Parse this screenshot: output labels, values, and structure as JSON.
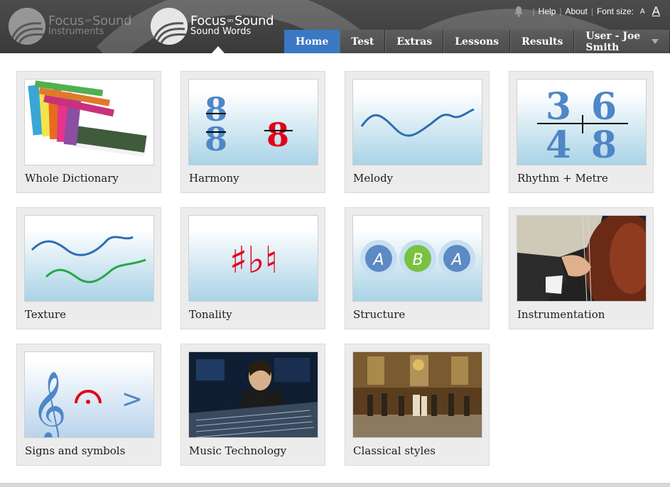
{
  "header": {
    "logos": [
      {
        "brand_a": "Focus",
        "brand_on": "on",
        "brand_b": "Sound",
        "sub": "Instruments"
      },
      {
        "brand_a": "Focus",
        "brand_on": "on",
        "brand_b": "Sound",
        "sub": "Sound Words"
      }
    ],
    "utility": {
      "bell_icon": "bell-icon",
      "help": "Help",
      "about": "About",
      "font_size_label": "Font size:",
      "font_small": "A",
      "font_large": "A"
    },
    "nav": [
      {
        "label": "Home",
        "active": true
      },
      {
        "label": "Test"
      },
      {
        "label": "Extras"
      },
      {
        "label": "Lessons"
      },
      {
        "label": "Results"
      },
      {
        "label": "User - Joe Smith",
        "dropdown": true
      }
    ],
    "accent_color": "#3a78c3"
  },
  "cards": [
    {
      "label": "Whole Dictionary",
      "icon": "books-image"
    },
    {
      "label": "Harmony",
      "icon": "harmony-icon",
      "glyphs": [
        "8",
        "8",
        "8",
        "8"
      ]
    },
    {
      "label": "Melody",
      "icon": "melody-line-icon"
    },
    {
      "label": "Rhythm + Metre",
      "icon": "time-signature-icon",
      "glyphs": [
        "3",
        "4",
        "6",
        "8"
      ]
    },
    {
      "label": "Texture",
      "icon": "texture-lines-icon"
    },
    {
      "label": "Tonality",
      "icon": "accidentals-icon",
      "glyphs": "♯♭♮"
    },
    {
      "label": "Structure",
      "icon": "aba-form-icon",
      "glyphs": [
        "A",
        "B",
        "A"
      ]
    },
    {
      "label": "Instrumentation",
      "icon": "double-bass-photo"
    },
    {
      "label": "Signs and symbols",
      "icon": "signs-symbols-icon",
      "glyphs": [
        "𝄞",
        ">"
      ]
    },
    {
      "label": "Music Technology",
      "icon": "mixing-desk-photo"
    },
    {
      "label": "Classical styles",
      "icon": "baroque-painting"
    }
  ]
}
